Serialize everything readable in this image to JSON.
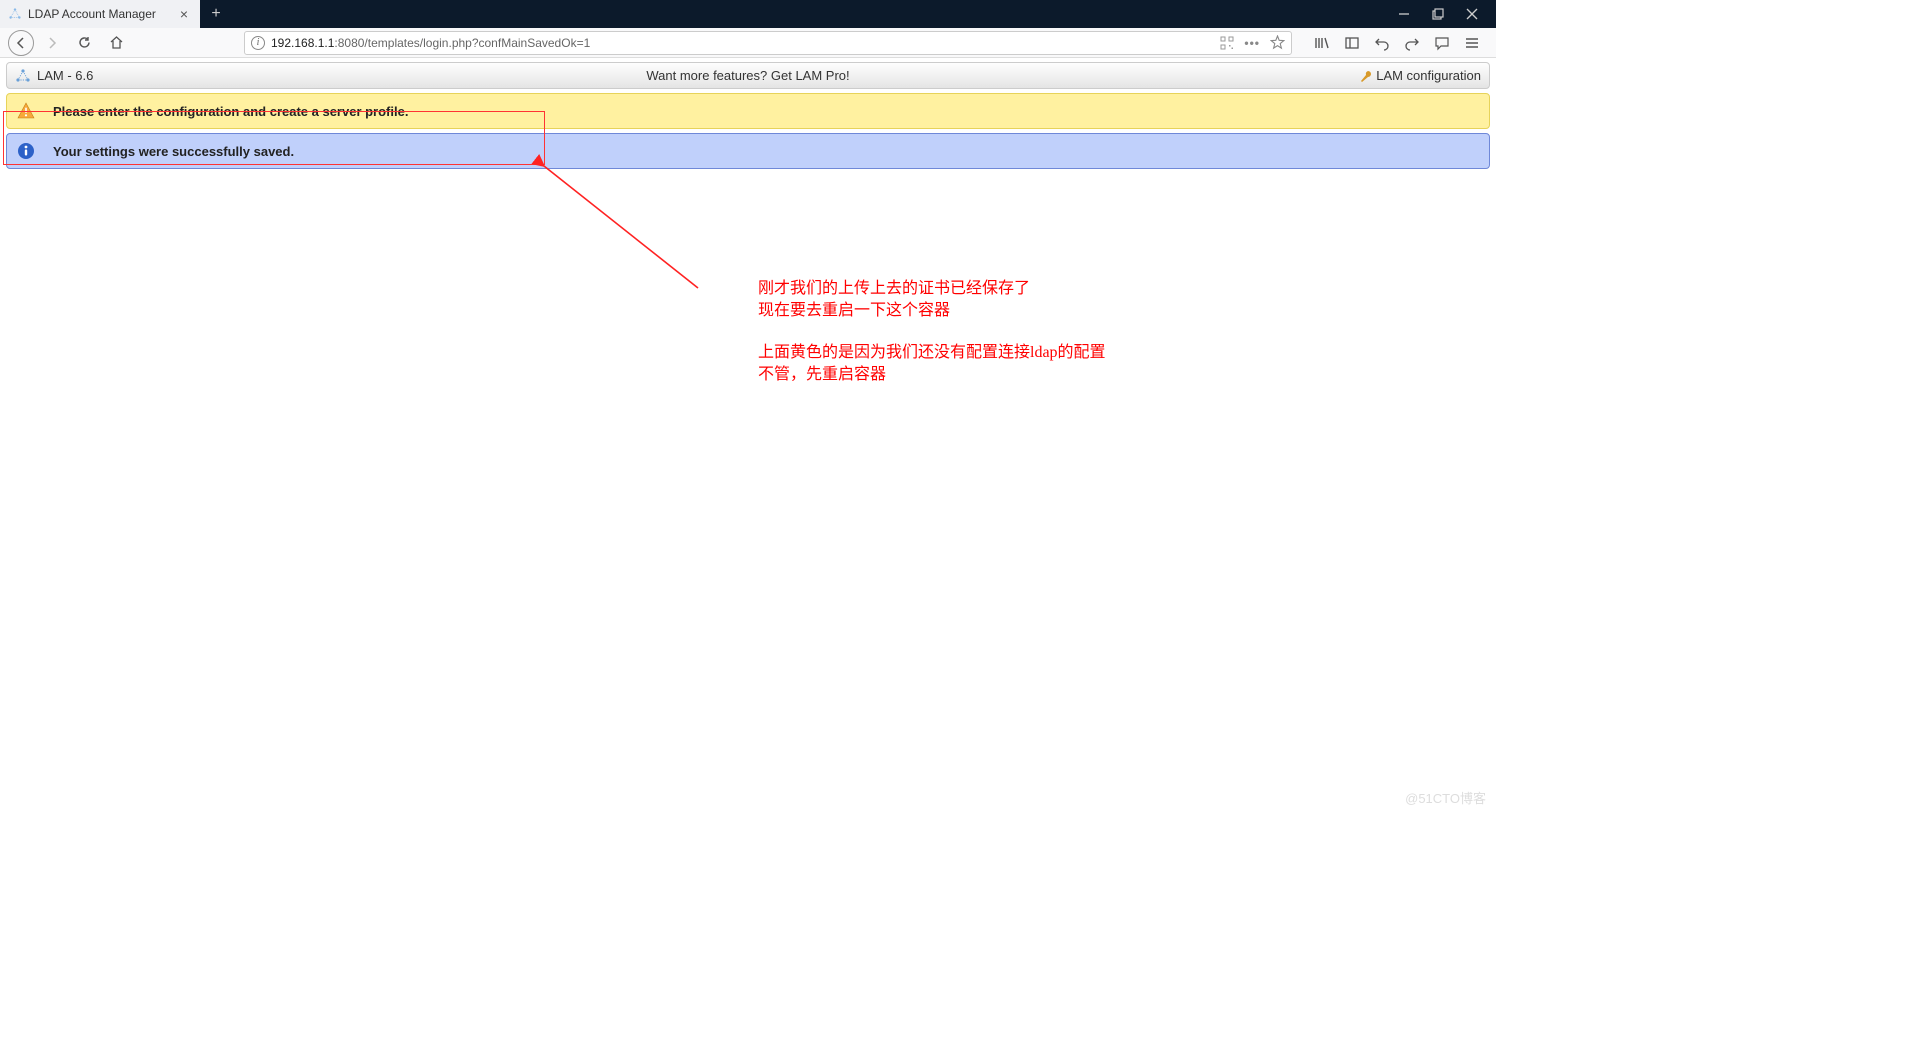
{
  "browser": {
    "tab_title": "LDAP Account Manager",
    "url_ip": "192.168.1.1",
    "url_rest": ":8080/templates/login.php?confMainSavedOk=1"
  },
  "lam": {
    "brand": "LAM - 6.6",
    "promo": "Want more features? Get LAM Pro!",
    "config_link": "LAM configuration"
  },
  "alerts": {
    "warn": "Please enter the configuration and create a server profile.",
    "info": "Your settings were successfully saved."
  },
  "annotations": {
    "text1_line1": "刚才我们的上传上去的证书已经保存了",
    "text1_line2": "现在要去重启一下这个容器",
    "text2_line1": "上面黄色的是因为我们还没有配置连接ldap的配置",
    "text2_line2": "不管，先重启容器"
  },
  "watermark": "@51CTO博客"
}
